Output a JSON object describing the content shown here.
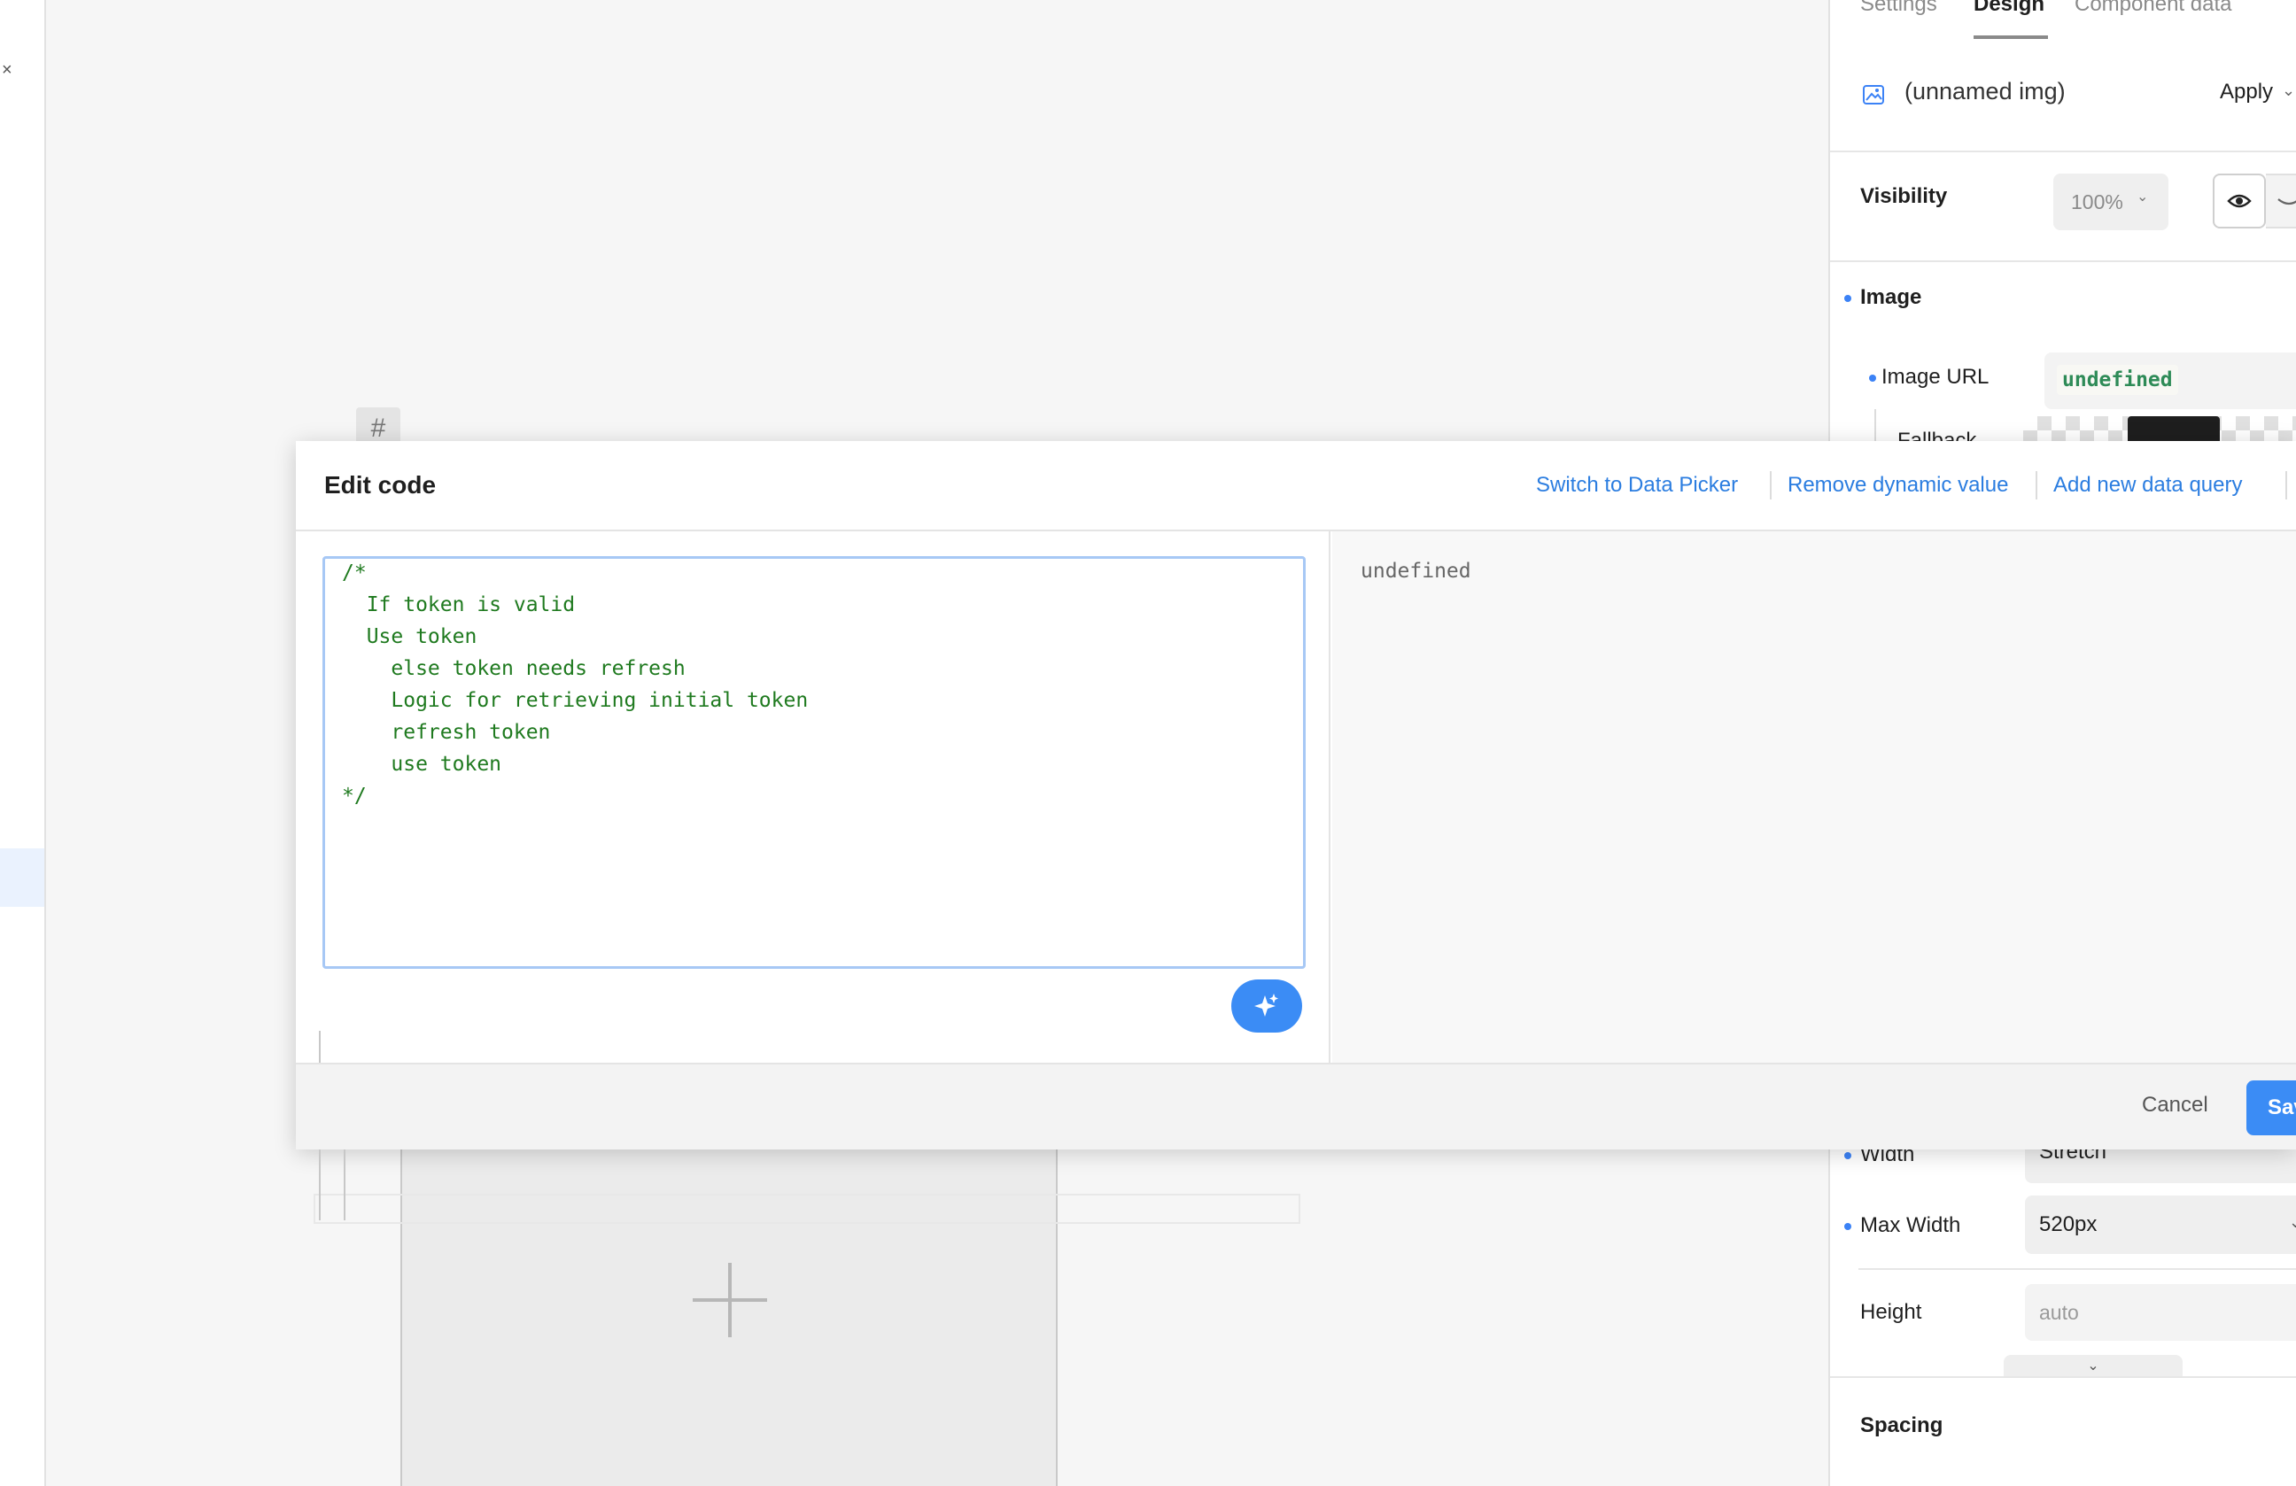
{
  "rail": {
    "collapse_glyph": "×"
  },
  "panel": {
    "tabs": [
      {
        "label": "Settings"
      },
      {
        "label": "Design"
      },
      {
        "label": "Component data"
      }
    ],
    "component_name": "(unnamed img)",
    "apply_label": "Apply",
    "visibility": {
      "label": "Visibility",
      "opacity": "100%"
    },
    "image_section": {
      "label": "Image",
      "url_label": "Image URL",
      "url_value": "undefined",
      "fallback_label": "Fallback"
    },
    "layout": {
      "width_label": "Width",
      "width_value": "Stretch",
      "max_width_label": "Max Width",
      "max_width_value": "520px",
      "height_label": "Height",
      "height_placeholder": "auto"
    },
    "spacing_label": "Spacing"
  },
  "modal": {
    "title": "Edit code",
    "links": {
      "switch": "Switch to Data Picker",
      "remove": "Remove dynamic value",
      "add_query": "Add new data query"
    },
    "code_lines": [
      "/*",
      "  If token is valid",
      "  Use token",
      "    else token needs refresh",
      "    Logic for retrieving initial token",
      "    refresh token",
      "    use token",
      "*/"
    ],
    "preview": "undefined",
    "cancel_label": "Cancel",
    "save_label": "Save"
  },
  "colors": {
    "accent": "#3b8cf5",
    "link": "#2b7de0",
    "code_comment": "#1f7a1f",
    "code_value": "#2e8b57"
  }
}
